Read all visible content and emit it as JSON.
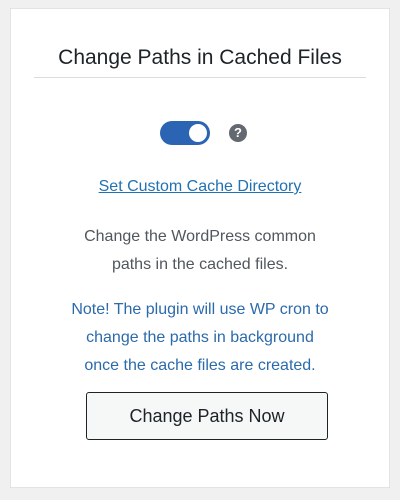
{
  "panel": {
    "title": "Change Paths in Cached Files",
    "toggle": {
      "state": "on",
      "accent_color": "#2c64b4"
    },
    "help_icon": {
      "icon": "question-circle-icon",
      "glyph": "?"
    },
    "custom_dir_link": "Set Custom Cache Directory",
    "description_lines": [
      "Change the WordPress common",
      "paths in the cached files."
    ],
    "note_lines": [
      "Note! The plugin will use WP cron to",
      "change the paths in background",
      "once the cache files are created."
    ],
    "action_button": "Change Paths Now"
  },
  "colors": {
    "link": "#2271b1",
    "note": "#2b6aab",
    "description": "#50575e"
  }
}
